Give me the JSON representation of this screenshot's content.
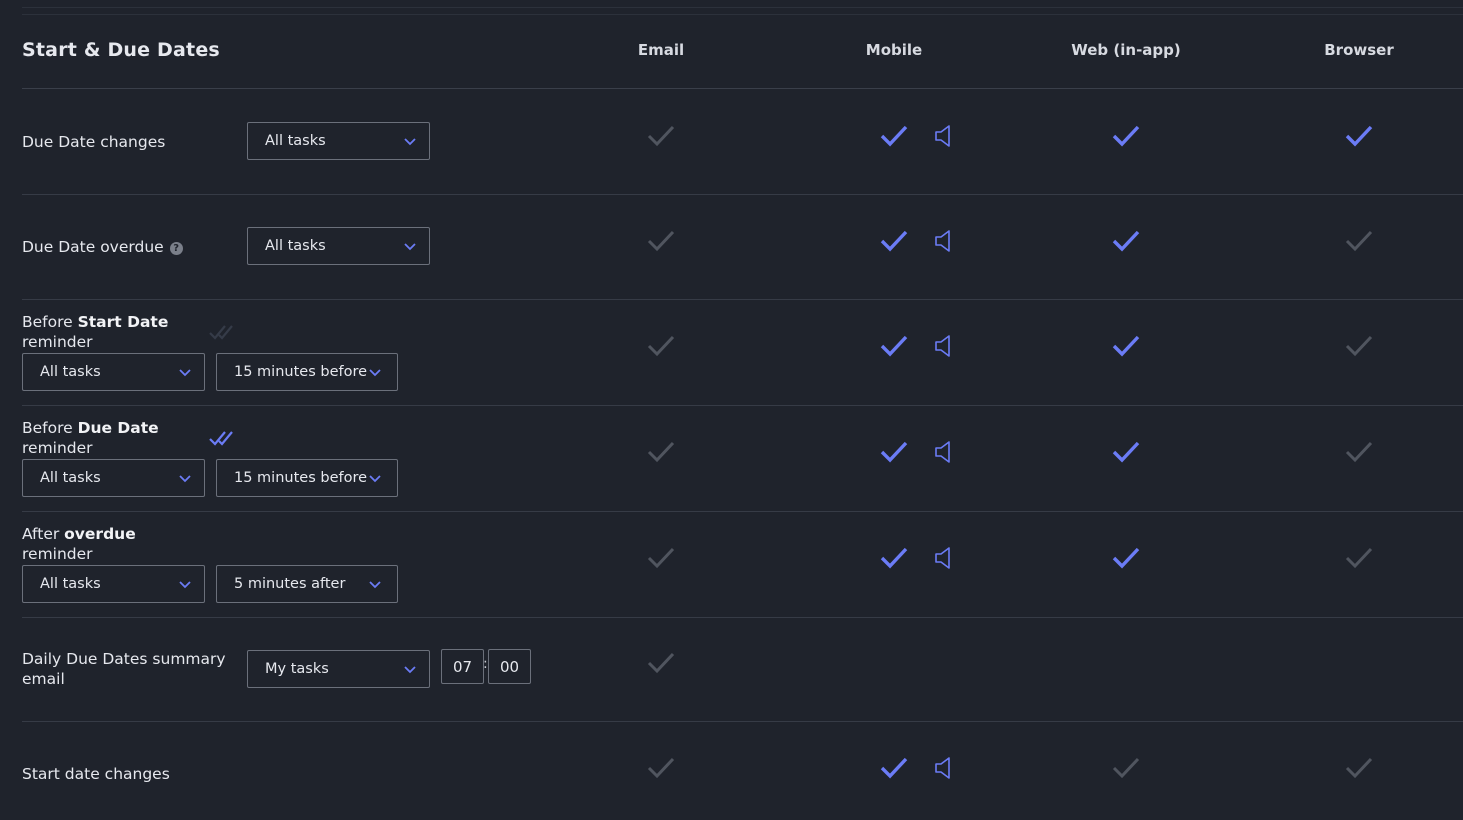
{
  "section": {
    "title": "Start & Due Dates"
  },
  "columns": [
    {
      "key": "email",
      "label": "Email"
    },
    {
      "key": "mobile",
      "label": "Mobile"
    },
    {
      "key": "web",
      "label": "Web (in-app)"
    },
    {
      "key": "browser",
      "label": "Browser"
    }
  ],
  "colors": {
    "background": "#1f232c",
    "accent_check": "#6b7cf6",
    "inactive_check": "#50555f",
    "divider": "#363b46"
  },
  "rows": [
    {
      "label_parts": [
        "Due Date changes"
      ],
      "selects": [
        "All tasks"
      ],
      "email": false,
      "mobile": true,
      "mobile_sound": true,
      "web": true,
      "browser": true
    },
    {
      "label_parts": [
        "Due Date overdue"
      ],
      "help": true,
      "selects": [
        "All tasks"
      ],
      "email": false,
      "mobile": true,
      "mobile_sound": true,
      "web": true,
      "browser": false
    },
    {
      "label_parts": [
        "Before ",
        "Start Date",
        " reminder"
      ],
      "selects": [
        "All tasks",
        "15 minutes before"
      ],
      "email": false,
      "mobile": true,
      "mobile_sound": true,
      "web": true,
      "browser": false
    },
    {
      "label_parts": [
        "Before ",
        "Due Date",
        " reminder"
      ],
      "selects": [
        "All tasks",
        "15 minutes before"
      ],
      "email": false,
      "mobile": true,
      "mobile_sound": true,
      "web": true,
      "browser": false
    },
    {
      "label_parts": [
        "After ",
        "overdue",
        " reminder"
      ],
      "selects": [
        "All tasks",
        "5 minutes after"
      ],
      "email": false,
      "mobile": true,
      "mobile_sound": true,
      "web": true,
      "browser": false
    },
    {
      "label_parts": [
        "Daily Due Dates summary email"
      ],
      "selects": [
        "My tasks"
      ],
      "time": {
        "hour": "07",
        "minute": "00"
      },
      "email": false
    },
    {
      "label_parts": [
        "Start date changes"
      ],
      "email": false,
      "mobile": true,
      "mobile_sound": true,
      "web": false,
      "browser": false
    }
  ]
}
